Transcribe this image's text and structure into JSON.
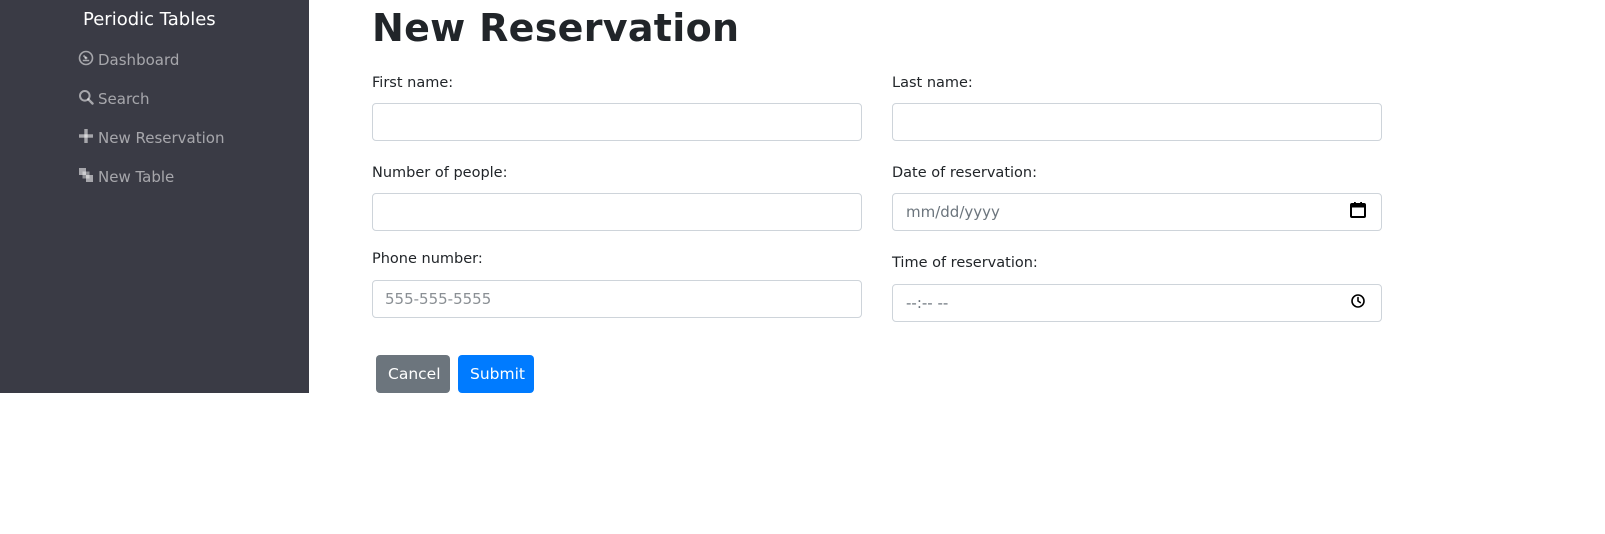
{
  "sidebar": {
    "brand": "Periodic Tables",
    "items": [
      {
        "label": "Dashboard",
        "icon": "dashboard-icon"
      },
      {
        "label": "Search",
        "icon": "search-icon"
      },
      {
        "label": "New Reservation",
        "icon": "plus-icon"
      },
      {
        "label": "New Table",
        "icon": "layers-icon"
      }
    ]
  },
  "main": {
    "title": "New Reservation",
    "form": {
      "first_name": {
        "label": "First name:",
        "value": "",
        "placeholder": ""
      },
      "last_name": {
        "label": "Last name:",
        "value": "",
        "placeholder": ""
      },
      "people": {
        "label": "Number of people:",
        "value": "",
        "placeholder": ""
      },
      "date": {
        "label": "Date of reservation:",
        "placeholder": "mm/dd/yyyy",
        "icon": "calendar-icon"
      },
      "phone": {
        "label": "Phone number:",
        "value": "",
        "placeholder": "555-555-5555"
      },
      "time": {
        "label": "Time of reservation:",
        "placeholder": "--:-- --",
        "icon": "clock-icon"
      }
    },
    "buttons": {
      "cancel": "Cancel",
      "submit": "Submit"
    }
  },
  "colors": {
    "sidebar_bg": "#3a3b45",
    "primary": "#007bff",
    "secondary": "#6c757d",
    "border": "#ced4da"
  }
}
